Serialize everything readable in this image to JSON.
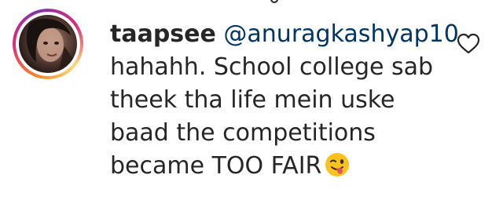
{
  "comment": {
    "username": "taapsee",
    "mention": "@anuragkashyap10",
    "lines": [
      "hahahh. School college sab",
      "theek tha life mein uske",
      "baad the competitions",
      "became TOO FAIR"
    ],
    "emoji": "winking-face-with-tongue-icon",
    "like_icon": "heart-outline-icon"
  },
  "colors": {
    "text": "#262626",
    "mention": "#003569",
    "ring_gradient": [
      "#f58529",
      "#dd2a7b",
      "#8134af",
      "#feda77"
    ]
  }
}
